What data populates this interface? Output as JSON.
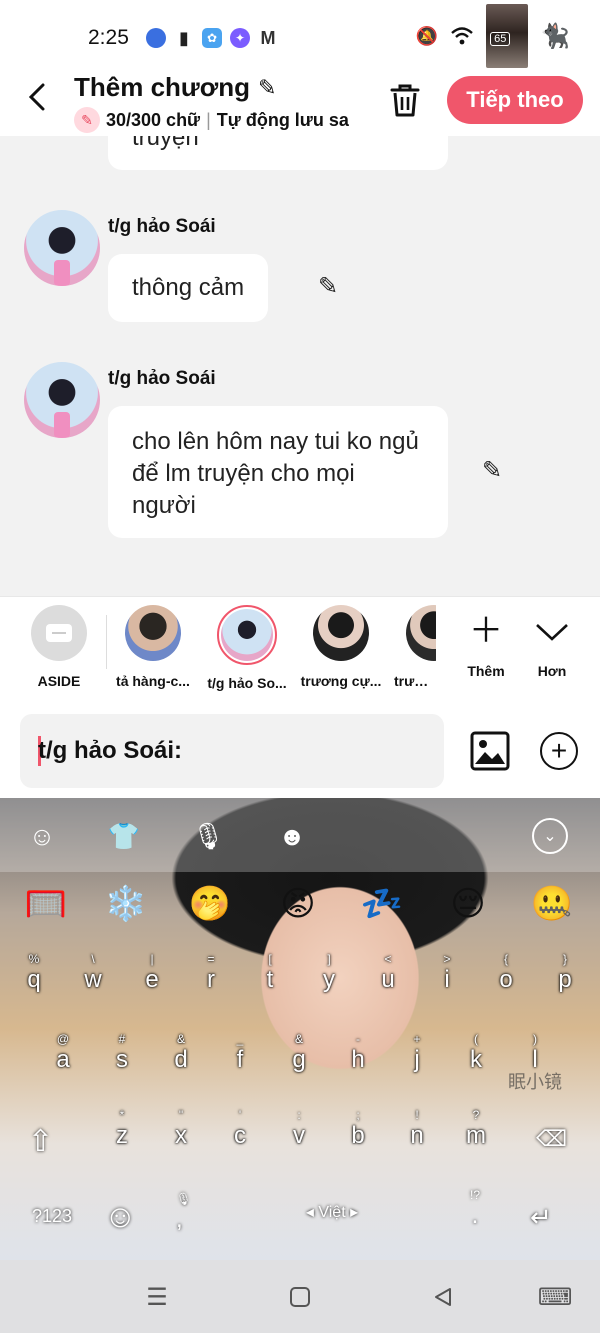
{
  "status_bar": {
    "time": "2:25",
    "battery": "65",
    "apps": [
      {
        "icon": "app-circle-icon",
        "color": "#3a6fe0"
      },
      {
        "icon": "brush-icon",
        "color": "#222222"
      },
      {
        "icon": "flower-icon",
        "color": "#4aa3f0"
      },
      {
        "icon": "messenger-icon",
        "color": "#7b5cff"
      },
      {
        "icon": "gmail-icon",
        "color": "#333333"
      }
    ]
  },
  "header": {
    "title": "Thêm chương",
    "word_count": "30/300 chữ",
    "separator": "|",
    "autosave": "Tự động lưu sa",
    "next_button": "Tiếp theo",
    "accent_color": "#f0566b"
  },
  "chat": {
    "partial_message": "truyện",
    "messages": [
      {
        "sender": "t/g hảo Soái",
        "text": "thông cảm"
      },
      {
        "sender": "t/g hảo Soái",
        "text": "cho lên hôm nay tui ko ngủ để lm truyện cho mọi người"
      }
    ]
  },
  "characters": [
    {
      "name": "ASIDE"
    },
    {
      "name": "tả hàng-c..."
    },
    {
      "name": "t/g hảo So...",
      "selected": true
    },
    {
      "name": "trương cự..."
    },
    {
      "name": "trương"
    }
  ],
  "actions": {
    "add_label": "Thêm",
    "more_label": "Hơn"
  },
  "input": {
    "value": "t/g hảo Soái:"
  },
  "keyboard": {
    "emojis": [
      "🥅",
      "❄️",
      "🤭",
      "😡",
      "💤",
      "😔",
      "🤐"
    ],
    "row1": [
      {
        "hint": "%",
        "ch": "q"
      },
      {
        "hint": "\\",
        "ch": "w"
      },
      {
        "hint": "|",
        "ch": "e"
      },
      {
        "hint": "=",
        "ch": "r"
      },
      {
        "hint": "[",
        "ch": "t"
      },
      {
        "hint": "]",
        "ch": "y"
      },
      {
        "hint": "<",
        "ch": "u"
      },
      {
        "hint": ">",
        "ch": "i"
      },
      {
        "hint": "{",
        "ch": "o"
      },
      {
        "hint": "}",
        "ch": "p"
      }
    ],
    "row2": [
      {
        "hint": "@",
        "ch": "a"
      },
      {
        "hint": "#",
        "ch": "s"
      },
      {
        "hint": "&",
        "ch": "d"
      },
      {
        "hint": "_",
        "ch": "f"
      },
      {
        "hint": "&",
        "ch": "g"
      },
      {
        "hint": "-",
        "ch": "h"
      },
      {
        "hint": "+",
        "ch": "j"
      },
      {
        "hint": "(",
        "ch": "k"
      },
      {
        "hint": ")",
        "ch": "l"
      }
    ],
    "row3": [
      {
        "hint": "*",
        "ch": "z"
      },
      {
        "hint": "\"",
        "ch": "x"
      },
      {
        "hint": "'",
        "ch": "c"
      },
      {
        "hint": ":",
        "ch": "v"
      },
      {
        "hint": ";",
        "ch": "b"
      },
      {
        "hint": "!",
        "ch": "n"
      },
      {
        "hint": "?",
        "ch": "m"
      }
    ],
    "numbers_key": "?123",
    "comma": ",",
    "space_label": "Việt",
    "period": ".",
    "period_hint": "!?",
    "watermark": "眠小镜"
  }
}
